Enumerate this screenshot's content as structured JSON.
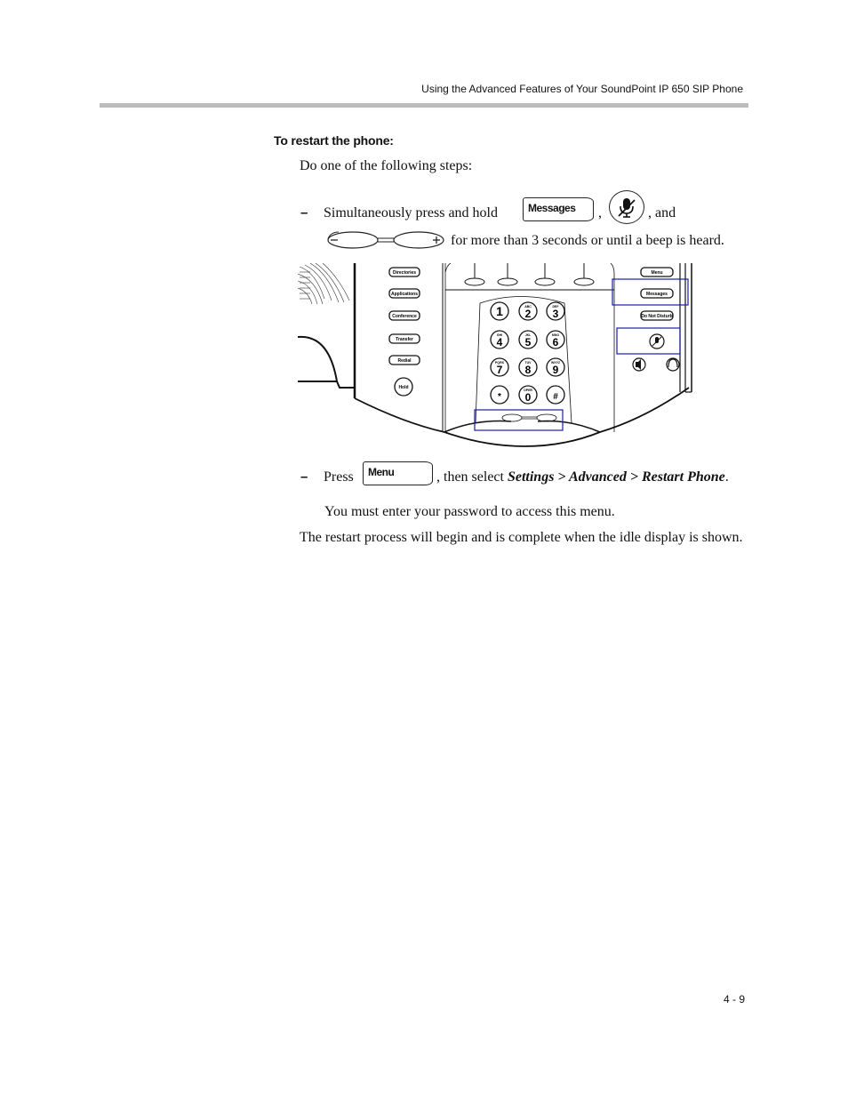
{
  "header": {
    "running_title": "Using the Advanced Features of Your SoundPoint IP 650 SIP Phone"
  },
  "procedure": {
    "title": "To restart the phone:",
    "intro": "Do one of the following steps:",
    "step1": {
      "bullet": "–",
      "text_before": "Simultaneously press and hold",
      "key_messages": "Messages",
      "sep1": ",",
      "key_mute_icon": "mute-icon",
      "sep2": ", and",
      "key_volume_icon": "volume-rocker-icon",
      "text_after": "for more than 3 seconds or until a beep is heard."
    },
    "step2": {
      "bullet": "–",
      "text_before": "Press",
      "key_menu": "Menu",
      "text_mid": ", then select ",
      "path": "Settings > Advanced > Restart Phone",
      "text_end": ".",
      "note": "You must enter your password to access this menu."
    },
    "result": "The restart process will begin and is complete when the idle display is shown."
  },
  "phone_diagram": {
    "left_keys": [
      "Directories",
      "Applications",
      "Conference",
      "Transfer",
      "Redial"
    ],
    "hold_key": "Hold",
    "right_keys": [
      "Menu",
      "Messages",
      "Do Not Disturb"
    ],
    "dialpad": [
      {
        "digit": "1",
        "letters": ""
      },
      {
        "digit": "2",
        "letters": "ABC"
      },
      {
        "digit": "3",
        "letters": "DEF"
      },
      {
        "digit": "4",
        "letters": "GHI"
      },
      {
        "digit": "5",
        "letters": "JKL"
      },
      {
        "digit": "6",
        "letters": "MNO"
      },
      {
        "digit": "7",
        "letters": "PQRS"
      },
      {
        "digit": "8",
        "letters": "TUV"
      },
      {
        "digit": "9",
        "letters": "WXYZ"
      },
      {
        "digit": "*",
        "letters": ""
      },
      {
        "digit": "0",
        "letters": "OPER"
      },
      {
        "digit": "#",
        "letters": ""
      }
    ],
    "highlight_color": "#1a1aa8",
    "icons": [
      "mute-icon",
      "speaker-icon",
      "headset-icon",
      "volume-rocker-icon"
    ]
  },
  "footer": {
    "page_number": "4 - 9"
  }
}
